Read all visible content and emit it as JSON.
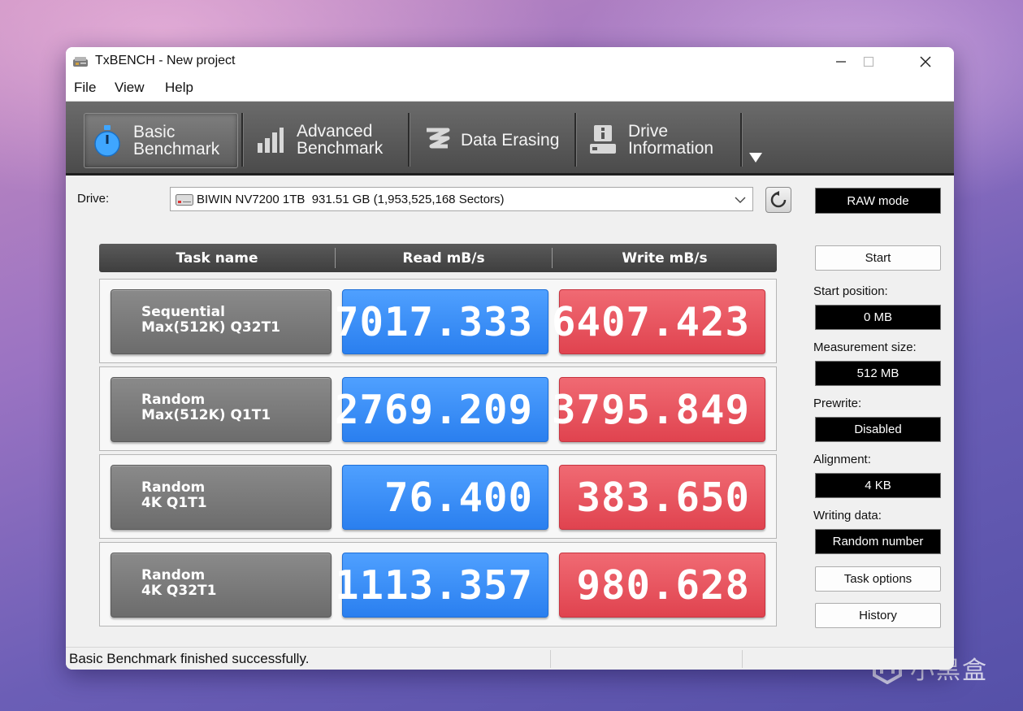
{
  "window": {
    "title": "TxBENCH - New project"
  },
  "menu": [
    "File",
    "View",
    "Help"
  ],
  "tabs": [
    {
      "line1": "Basic",
      "line2": "Benchmark",
      "icon": "stopwatch-icon",
      "active": true
    },
    {
      "line1": "Advanced",
      "line2": "Benchmark",
      "icon": "bar-chart-icon",
      "active": false
    },
    {
      "line1": "Data Erasing",
      "line2": "",
      "icon": "eraser-icon",
      "active": false
    },
    {
      "line1": "Drive",
      "line2": "Information",
      "icon": "drive-info-icon",
      "active": false
    }
  ],
  "drive": {
    "label": "Drive:",
    "value": "BIWIN NV7200 1TB  931.51 GB (1,953,525,168 Sectors)"
  },
  "raw_mode": "RAW mode",
  "grid": {
    "headers": [
      "Task name",
      "Read mB/s",
      "Write mB/s"
    ],
    "rows": [
      {
        "line1": "Sequential",
        "line2": "Max(512K) Q32T1",
        "read": "7017.333",
        "write": "6407.423"
      },
      {
        "line1": "Random",
        "line2": "Max(512K) Q1T1",
        "read": "2769.209",
        "write": "3795.849"
      },
      {
        "line1": "Random",
        "line2": "4K Q1T1",
        "read": "76.400",
        "write": "383.650"
      },
      {
        "line1": "Random",
        "line2": "4K Q32T1",
        "read": "1113.357",
        "write": "980.628"
      }
    ]
  },
  "side": {
    "start": "Start",
    "start_position_label": "Start position:",
    "start_position": "0 MB",
    "measurement_size_label": "Measurement size:",
    "measurement_size": "512 MB",
    "prewrite_label": "Prewrite:",
    "prewrite": "Disabled",
    "alignment_label": "Alignment:",
    "alignment": "4 KB",
    "writing_data_label": "Writing data:",
    "writing_data": "Random number",
    "task_options": "Task options",
    "history": "History"
  },
  "status": "Basic Benchmark finished successfully.",
  "watermark": "小黑盒",
  "colors": {
    "read": "#2f86f4",
    "write": "#e44c57",
    "toolbar": "#555555"
  }
}
